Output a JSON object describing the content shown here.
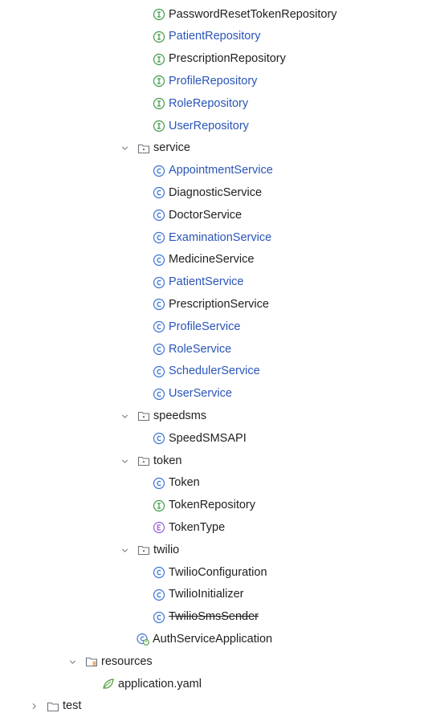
{
  "colors": {
    "text_default": "#1f1f1f",
    "text_modified": "#2a55b8",
    "interface_icon": "#3f9a4a",
    "class_icon": "#3b73d6",
    "enum_icon": "#9a5ed6",
    "folder_icon": "#6e727a",
    "chevron": "#7a7d85"
  },
  "tree": {
    "items": [
      {
        "label": "PasswordResetTokenRepository",
        "icon": "interface-icon",
        "status": "normal"
      },
      {
        "label": "PatientRepository",
        "icon": "interface-icon",
        "status": "modified"
      },
      {
        "label": "PrescriptionRepository",
        "icon": "interface-icon",
        "status": "normal"
      },
      {
        "label": "ProfileRepository",
        "icon": "interface-icon",
        "status": "modified"
      },
      {
        "label": "RoleRepository",
        "icon": "interface-icon",
        "status": "modified"
      },
      {
        "label": "UserRepository",
        "icon": "interface-icon",
        "status": "modified"
      },
      {
        "label": "service",
        "icon": "package-folder-icon",
        "status": "normal",
        "expanded": true
      },
      {
        "label": "AppointmentService",
        "icon": "class-icon",
        "status": "modified"
      },
      {
        "label": "DiagnosticService",
        "icon": "class-icon",
        "status": "normal"
      },
      {
        "label": "DoctorService",
        "icon": "class-icon",
        "status": "normal"
      },
      {
        "label": "ExaminationService",
        "icon": "class-icon",
        "status": "modified"
      },
      {
        "label": "MedicineService",
        "icon": "class-icon",
        "status": "normal"
      },
      {
        "label": "PatientService",
        "icon": "class-icon",
        "status": "modified"
      },
      {
        "label": "PrescriptionService",
        "icon": "class-icon",
        "status": "normal"
      },
      {
        "label": "ProfileService",
        "icon": "class-icon",
        "status": "modified"
      },
      {
        "label": "RoleService",
        "icon": "class-icon",
        "status": "modified"
      },
      {
        "label": "SchedulerService",
        "icon": "class-icon",
        "status": "modified"
      },
      {
        "label": "UserService",
        "icon": "class-icon",
        "status": "modified"
      },
      {
        "label": "speedsms",
        "icon": "package-folder-icon",
        "status": "normal",
        "expanded": true
      },
      {
        "label": "SpeedSMSAPI",
        "icon": "class-icon",
        "status": "normal"
      },
      {
        "label": "token",
        "icon": "package-folder-icon",
        "status": "normal",
        "expanded": true
      },
      {
        "label": "Token",
        "icon": "class-icon",
        "status": "normal"
      },
      {
        "label": "TokenRepository",
        "icon": "interface-icon",
        "status": "normal"
      },
      {
        "label": "TokenType",
        "icon": "enum-icon",
        "status": "normal"
      },
      {
        "label": "twilio",
        "icon": "package-folder-icon",
        "status": "normal",
        "expanded": true
      },
      {
        "label": "TwilioConfiguration",
        "icon": "class-icon",
        "status": "normal"
      },
      {
        "label": "TwilioInitializer",
        "icon": "class-icon",
        "status": "normal"
      },
      {
        "label": "TwilioSmsSender",
        "icon": "class-icon",
        "status": "deleted"
      },
      {
        "label": "AuthServiceApplication",
        "icon": "spring-boot-class-icon",
        "status": "normal"
      },
      {
        "label": "resources",
        "icon": "resources-folder-icon",
        "status": "normal",
        "expanded": true
      },
      {
        "label": "application.yaml",
        "icon": "spring-yaml-icon",
        "status": "normal"
      },
      {
        "label": "test",
        "icon": "folder-icon",
        "status": "normal",
        "expanded": false
      }
    ]
  }
}
